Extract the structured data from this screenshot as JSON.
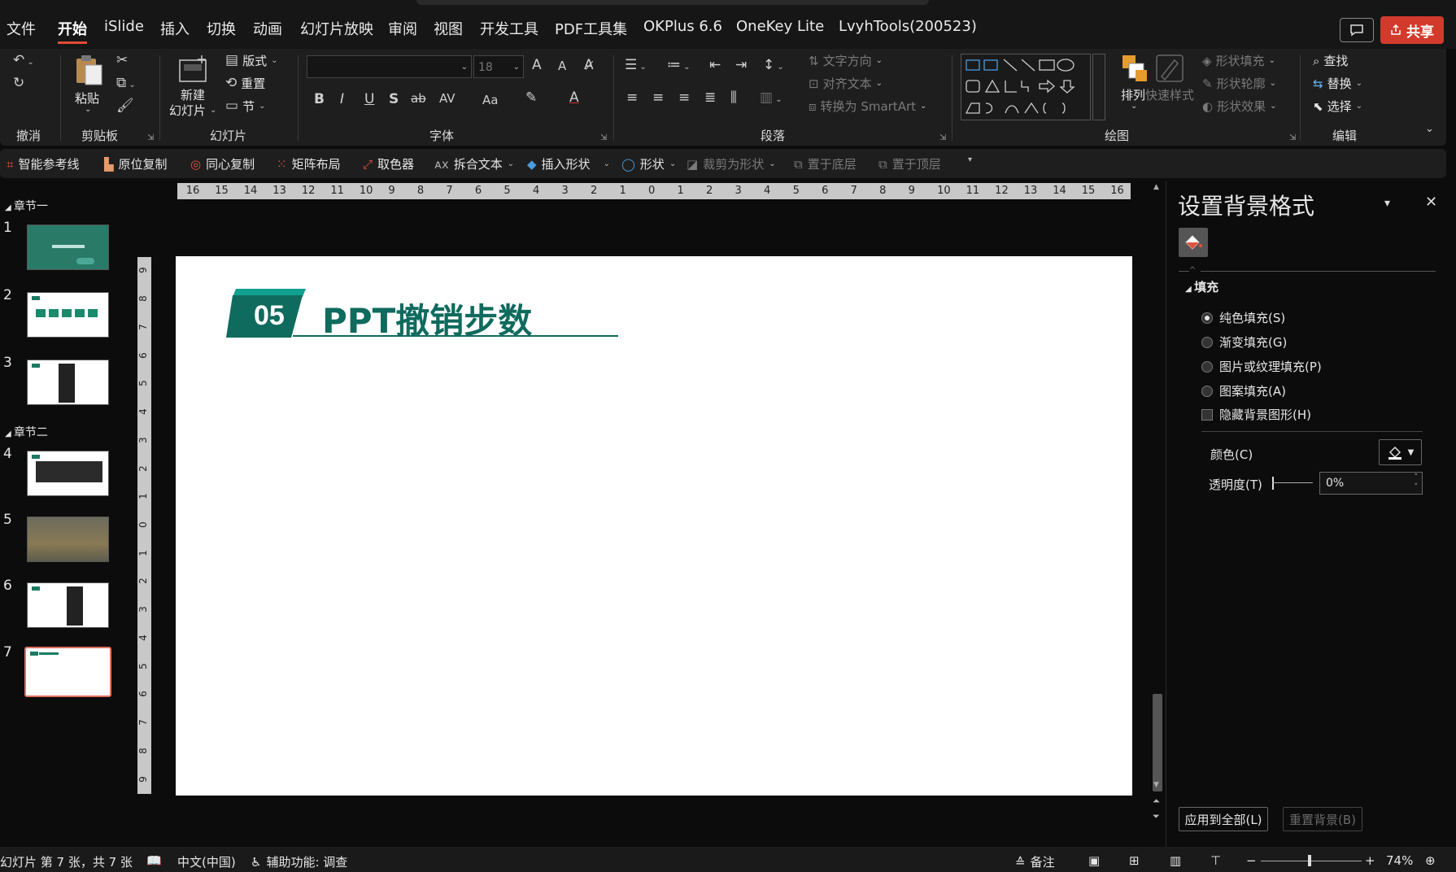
{
  "menu": {
    "tabs": [
      "文件",
      "开始",
      "iSlide",
      "插入",
      "切换",
      "动画",
      "幻灯片放映",
      "审阅",
      "视图",
      "开发工具",
      "PDF工具集",
      "OKPlus 6.6",
      "OneKey Lite",
      "LvyhTools(200523)"
    ],
    "active_tab": "开始",
    "share_label": "共享"
  },
  "ribbon": {
    "groups": {
      "undo": "撤消",
      "clipboard": "剪贴板",
      "slides": "幻灯片",
      "font": "字体",
      "paragraph": "段落",
      "drawing": "绘图",
      "editing": "编辑"
    },
    "paste_label": "粘贴",
    "new_slide_label_1": "新建",
    "new_slide_label_2": "幻灯片",
    "layout_label": "版式",
    "reset_label": "重置",
    "section_label": "节",
    "font_size_value": "18",
    "font_name_value": "",
    "bold": "B",
    "italic": "I",
    "underline": "U",
    "shadow": "S",
    "strike": "ab",
    "spacing": "AV",
    "case": "Aa",
    "grow": "A",
    "shrink": "A",
    "font_color": "A",
    "text_direction_label": "文字方向",
    "align_text_label": "对齐文本",
    "smartart_label": "转换为 SmartArt",
    "arrange_label": "排列",
    "quick_styles_label": "快速样式",
    "shape_fill_label": "形状填充",
    "shape_outline_label": "形状轮廓",
    "shape_effects_label": "形状效果",
    "find_label": "查找",
    "replace_label": "替换",
    "select_label": "选择"
  },
  "toolbar2": {
    "items": [
      "智能参考线",
      "原位复制",
      "同心复制",
      "矩阵布局",
      "取色器",
      "拆合文本",
      "插入形状",
      "形状",
      "裁剪为形状",
      "置于底层",
      "置于顶层"
    ]
  },
  "thumbnails": {
    "section1": "章节一",
    "section2": "章节二",
    "slide_numbers": [
      "1",
      "2",
      "3",
      "4",
      "5",
      "6",
      "7"
    ],
    "selected": 7
  },
  "ruler": {
    "h_labels": [
      "16",
      "15",
      "14",
      "13",
      "12",
      "11",
      "10",
      "9",
      "8",
      "7",
      "6",
      "5",
      "4",
      "3",
      "2",
      "1",
      "0",
      "1",
      "2",
      "3",
      "4",
      "5",
      "6",
      "7",
      "8",
      "9",
      "10",
      "11",
      "12",
      "13",
      "14",
      "15",
      "16"
    ],
    "v_labels": [
      "9",
      "8",
      "7",
      "6",
      "5",
      "4",
      "3",
      "2",
      "1",
      "0",
      "1",
      "2",
      "3",
      "4",
      "5",
      "6",
      "7",
      "8",
      "9"
    ]
  },
  "slide": {
    "badge_number": "05",
    "title": "PPT撤销步数",
    "accent_color": "#0f6b5e",
    "badge_light_color": "#12a090"
  },
  "format_pane": {
    "title": "设置背景格式",
    "fill_section": "填充",
    "options": [
      "纯色填充(S)",
      "渐变填充(G)",
      "图片或纹理填充(P)",
      "图案填充(A)"
    ],
    "selected_option": 0,
    "hide_bg_label": "隐藏背景图形(H)",
    "color_label": "颜色(C)",
    "transparency_label": "透明度(T)",
    "transparency_value": "0%",
    "apply_all_label": "应用到全部(L)",
    "reset_bg_label": "重置背景(B)"
  },
  "status": {
    "slide_info": "幻灯片 第 7 张，共 7 张",
    "language": "中文(中国)",
    "accessibility": "辅助功能: 调查",
    "notes": "备注",
    "zoom": "74%"
  }
}
